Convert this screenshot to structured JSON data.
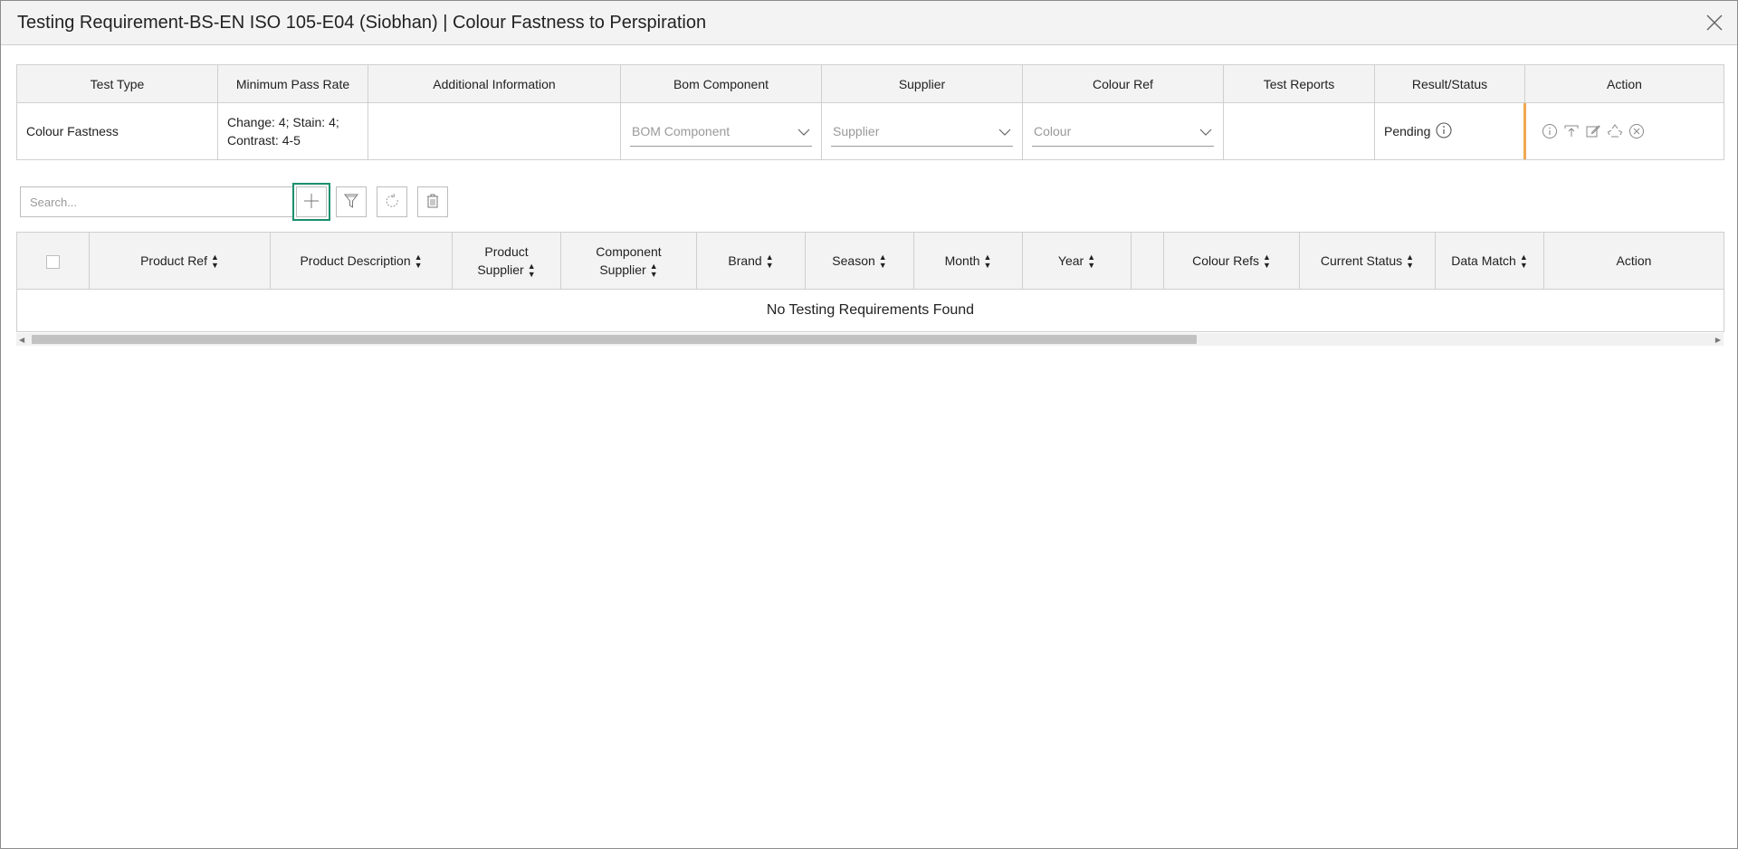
{
  "modal": {
    "title": "Testing Requirement-BS-EN ISO 105-E04 (Siobhan) | Colour Fastness to Perspiration"
  },
  "requirement": {
    "headers": [
      "Test Type",
      "Minimum Pass Rate",
      "Additional Information",
      "Bom Component",
      "Supplier",
      "Colour Ref",
      "Test Reports",
      "Result/Status",
      "Action"
    ],
    "row": {
      "test_type": "Colour Fastness",
      "min_pass_line1": "Change: 4; Stain: 4;",
      "min_pass_line2": "Contrast: 4-5",
      "additional_info": "",
      "bom_placeholder": "BOM Component",
      "supplier_placeholder": "Supplier",
      "colour_placeholder": "Colour",
      "test_reports": "",
      "status": "Pending",
      "status_color": "#f0a850"
    },
    "action_icons": [
      "info-icon",
      "upload-icon",
      "edit-icon",
      "recycle-icon",
      "cancel-icon"
    ]
  },
  "toolbar": {
    "search_placeholder": "Search...",
    "accent_color": "#1a8f6e"
  },
  "grid": {
    "headers": {
      "product_ref": "Product Ref",
      "product_description": "Product Description",
      "product_supplier_1": "Product",
      "product_supplier_2": "Supplier",
      "component_supplier_1": "Component",
      "component_supplier_2": "Supplier",
      "brand": "Brand",
      "season": "Season",
      "month": "Month",
      "year": "Year",
      "blank": "",
      "colour_refs": "Colour Refs",
      "current_status": "Current Status",
      "data_match": "Data Match",
      "action": "Action"
    },
    "empty_message": "No Testing Requirements Found"
  }
}
